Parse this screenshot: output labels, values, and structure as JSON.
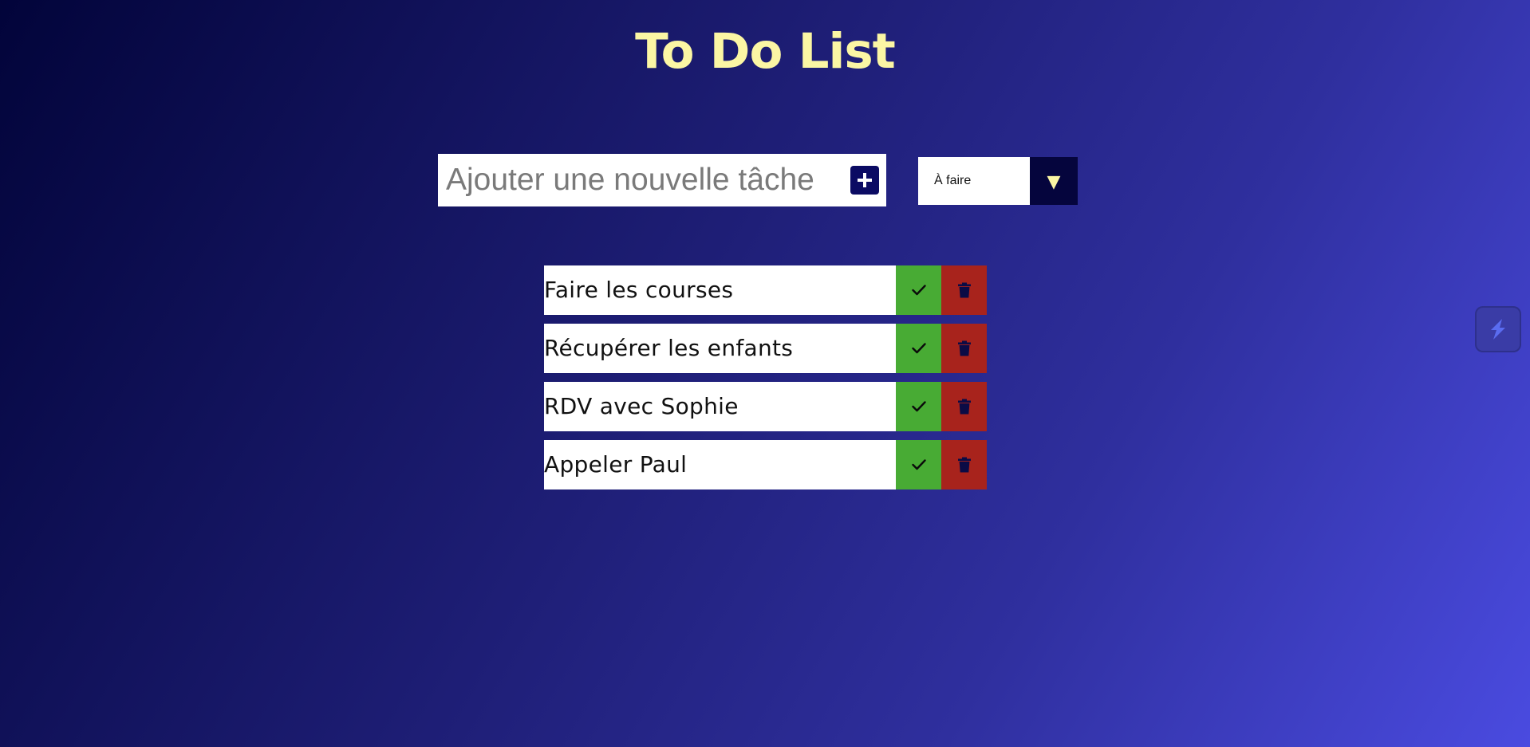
{
  "header": {
    "title": "To Do List"
  },
  "add_form": {
    "placeholder": "Ajouter une nouvelle tâche",
    "value": ""
  },
  "filter": {
    "selected": "À faire"
  },
  "todos": [
    {
      "text": "Faire les courses"
    },
    {
      "text": "Récupérer les enfants"
    },
    {
      "text": "RDV avec Sophie"
    },
    {
      "text": "Appeler Paul"
    }
  ],
  "colors": {
    "title": "#fbf6a4",
    "check": "#48ab34",
    "trash": "#a8231c",
    "accent": "#0b0b63"
  },
  "icons": {
    "add": "plus-icon",
    "filter": "triangle-down-icon",
    "check": "check-icon",
    "trash": "trash-icon",
    "extension": "bolt-icon"
  }
}
